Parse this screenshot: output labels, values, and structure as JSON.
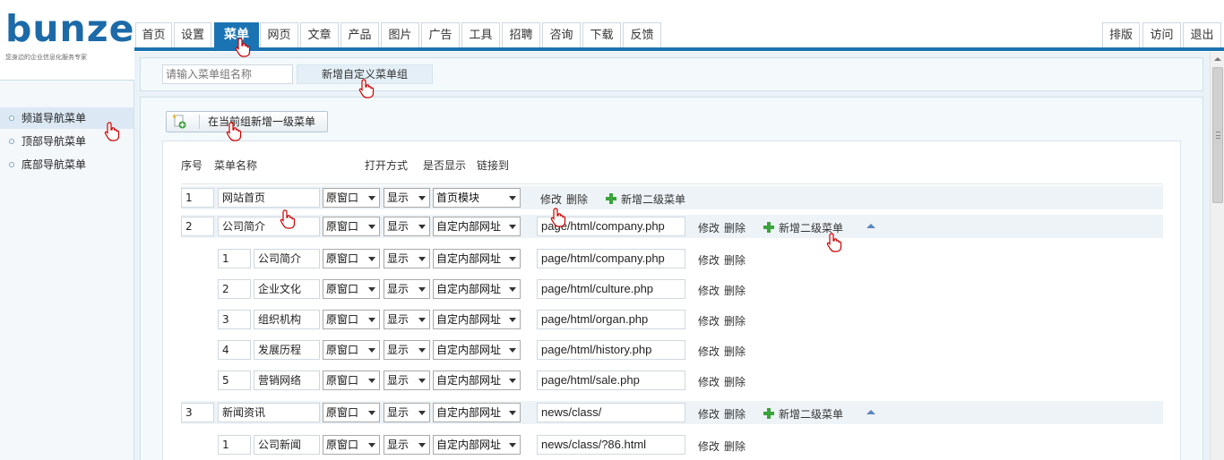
{
  "logo": {
    "text": "bunze",
    "slogan": "您身边的企业信息化服务专家",
    "brand_color": "#1c6aa8"
  },
  "nav": {
    "tabs": [
      "首页",
      "设置",
      "菜单",
      "网页",
      "文章",
      "产品",
      "图片",
      "广告",
      "工具",
      "招聘",
      "咨询",
      "下载",
      "反馈"
    ],
    "active": "菜单",
    "right": [
      "排版",
      "访问",
      "退出"
    ],
    "accent_color": "#1a74b3"
  },
  "sidebar": {
    "items": [
      "频道导航菜单",
      "顶部导航菜单",
      "底部导航菜单"
    ],
    "active": "频道导航菜单"
  },
  "group": {
    "placeholder": "请输入菜单组名称",
    "add_label": "新增自定义菜单组"
  },
  "toolbar": {
    "add_top_label": "在当前组新增一级菜单"
  },
  "columns": [
    "序号",
    "菜单名称",
    "打开方式",
    "是否显示",
    "链接到"
  ],
  "actions": {
    "edit": "修改",
    "delete": "删除",
    "add_sub": "新增二级菜单"
  },
  "rows": [
    {
      "level": 1,
      "num": "1",
      "name": "网站首页",
      "open": "原窗口",
      "show": "显示",
      "link_type": "首页模块",
      "url": "",
      "add_sub": true,
      "collapse": false
    },
    {
      "level": 1,
      "num": "2",
      "name": "公司简介",
      "open": "原窗口",
      "show": "显示",
      "link_type": "自定内部网址",
      "url": "page/html/company.php",
      "add_sub": true,
      "collapse": true
    },
    {
      "level": 2,
      "num": "1",
      "name": "公司简介",
      "open": "原窗口",
      "show": "显示",
      "link_type": "自定内部网址",
      "url": "page/html/company.php"
    },
    {
      "level": 2,
      "num": "2",
      "name": "企业文化",
      "open": "原窗口",
      "show": "显示",
      "link_type": "自定内部网址",
      "url": "page/html/culture.php"
    },
    {
      "level": 2,
      "num": "3",
      "name": "组织机构",
      "open": "原窗口",
      "show": "显示",
      "link_type": "自定内部网址",
      "url": "page/html/organ.php"
    },
    {
      "level": 2,
      "num": "4",
      "name": "发展历程",
      "open": "原窗口",
      "show": "显示",
      "link_type": "自定内部网址",
      "url": "page/html/history.php"
    },
    {
      "level": 2,
      "num": "5",
      "name": "营销网络",
      "open": "原窗口",
      "show": "显示",
      "link_type": "自定内部网址",
      "url": "page/html/sale.php"
    },
    {
      "level": 1,
      "num": "3",
      "name": "新闻资讯",
      "open": "原窗口",
      "show": "显示",
      "link_type": "自定内部网址",
      "url": "news/class/",
      "add_sub": true,
      "collapse": true
    },
    {
      "level": 2,
      "num": "1",
      "name": "公司新闻",
      "open": "原窗口",
      "show": "显示",
      "link_type": "自定内部网址",
      "url": "news/class/?86.html"
    }
  ]
}
